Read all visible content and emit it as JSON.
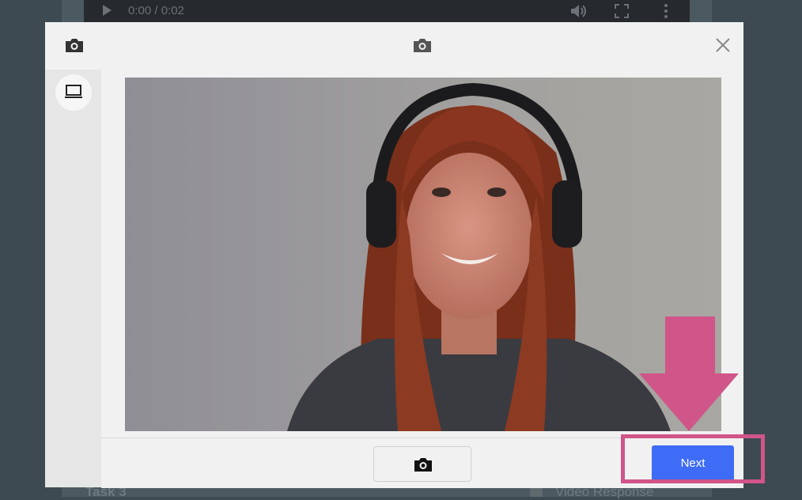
{
  "background": {
    "player_time": "0:00 / 0:02",
    "task_label": "Task 3",
    "response_label": "Video Response"
  },
  "modal": {
    "top_icon": "camera-icon",
    "center_icon": "camera-icon",
    "close_icon": "close-icon",
    "source_icon": "laptop-icon",
    "video": {
      "description": "webcam preview"
    },
    "footer": {
      "capture_icon": "camera-icon",
      "next_label": "Next"
    }
  },
  "colors": {
    "accent": "#3e6cf6",
    "annotation": "#d05589"
  }
}
